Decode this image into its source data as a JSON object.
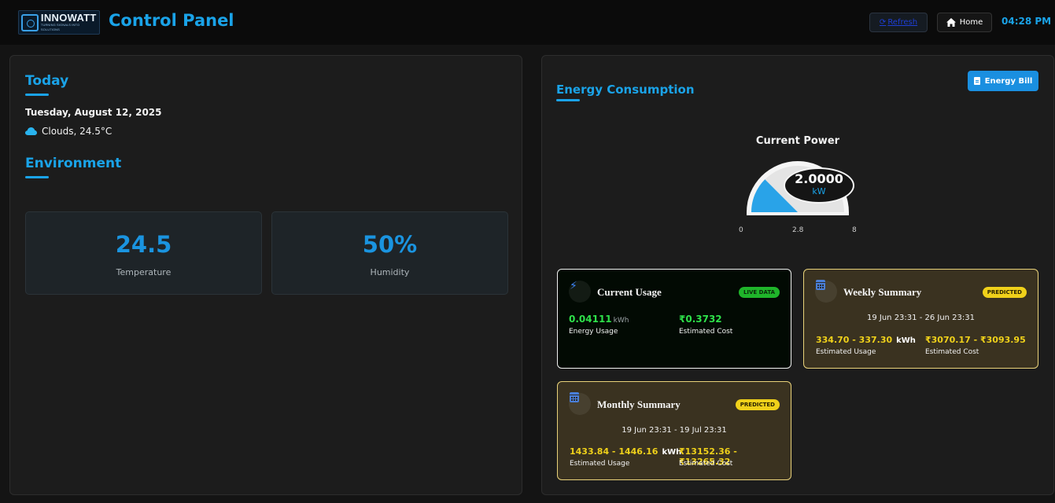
{
  "header": {
    "logo_name": "INNOWATT",
    "logo_tagline": "TURNING SIGNALS INTO SOLUTIONS",
    "title": "Control Panel",
    "refresh_label": "Refresh",
    "home_label": "Home",
    "time": "04:28 PM"
  },
  "today": {
    "title": "Today",
    "date": "Tuesday, August 12, 2025",
    "weather": "Clouds, 24.5°C"
  },
  "environment": {
    "title": "Environment",
    "temperature_value": "24.5",
    "temperature_label": "Temperature",
    "humidity_value": "50%",
    "humidity_label": "Humidity"
  },
  "energy": {
    "title": "Energy Consumption",
    "bill_button": "Energy Bill",
    "current_power_title": "Current Power",
    "gauge": {
      "value": "2.0000",
      "unit": "kW",
      "min": "0",
      "mid": "2.8",
      "max": "8",
      "fill_fraction": 0.25,
      "fill_color": "#29a3e8"
    },
    "current_usage": {
      "title": "Current Usage",
      "badge": "LIVE DATA",
      "energy_value": "0.04111",
      "energy_unit": "kWh",
      "energy_label": "Energy Usage",
      "cost_value": "₹0.3732",
      "cost_label": "Estimated Cost"
    },
    "weekly_summary": {
      "title": "Weekly Summary",
      "badge": "PREDICTED",
      "range": "19 Jun 23:31 - 26 Jun 23:31",
      "usage_value": "334.70 - 337.30",
      "usage_unit": "kWh",
      "usage_label": "Estimated Usage",
      "cost_value": "₹3070.17 - ₹3093.95",
      "cost_label": "Estimated Cost"
    },
    "monthly_summary": {
      "title": "Monthly Summary",
      "badge": "PREDICTED",
      "range": "19 Jun 23:31 - 19 Jul 23:31",
      "usage_value": "1433.84 - 1446.16",
      "usage_unit": "kWh",
      "usage_label": "Estimated Usage",
      "cost_value": "₹13152.36 - ₹13265.32",
      "cost_label": "Estimated Cost"
    }
  },
  "colors": {
    "accent": "#1aa3e8",
    "live_green": "#2ee04a",
    "predicted_yellow": "#f0d11a"
  }
}
